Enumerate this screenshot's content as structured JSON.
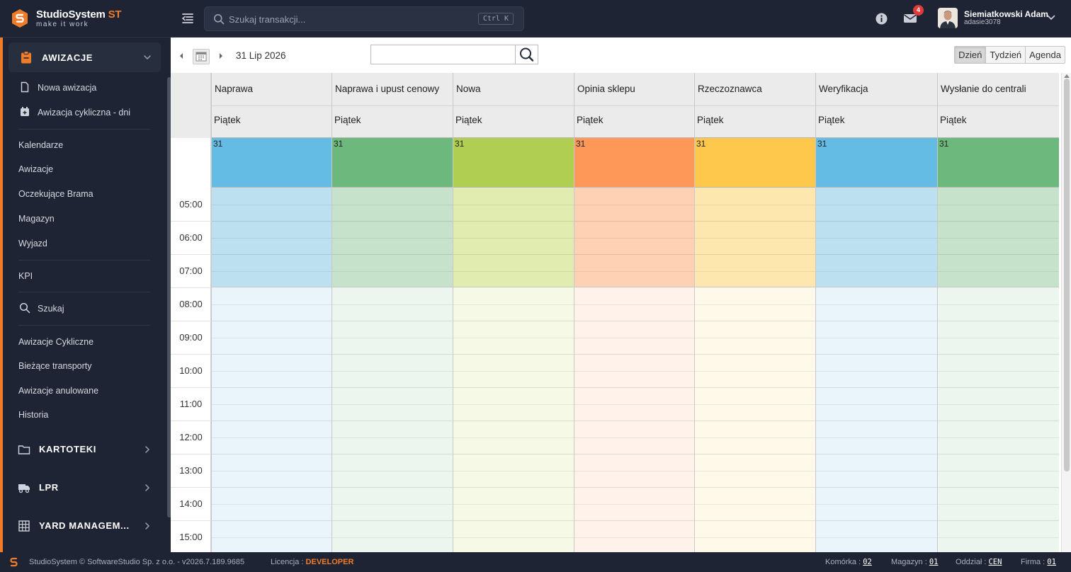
{
  "app": {
    "brand_name": "StudioSystem",
    "brand_suffix": "ST",
    "tagline": "make it work"
  },
  "header": {
    "search_placeholder": "Szukaj transakcji...",
    "search_shortcut": "Ctrl K",
    "notification_count": "4",
    "user_name": "Siemiatkowski Adam",
    "user_login": "adasie3078"
  },
  "sidebar": {
    "active_section": "AWIZACJE",
    "group1": [
      {
        "label": "Nowa awizacja",
        "icon": "document-icon"
      },
      {
        "label": "Awizacja cykliczna - dni",
        "icon": "calendar-plus-icon"
      }
    ],
    "group2": [
      "Kalendarze",
      "Awizacje",
      "Oczekujące Brama",
      "Magazyn",
      "Wyjazd"
    ],
    "group3": [
      "KPI"
    ],
    "search_item": "Szukaj",
    "group4": [
      "Awizacje Cykliczne",
      "Bieżące transporty",
      "Awizacje anulowane",
      "Historia"
    ],
    "sections": [
      {
        "label": "KARTOTEKI",
        "icon": "folder-icon"
      },
      {
        "label": "LPR",
        "icon": "truck-icon"
      },
      {
        "label": "YARD MANAGEM...",
        "icon": "grid-icon"
      }
    ]
  },
  "toolbar": {
    "date_label": "31 Lip 2026",
    "search_value": "",
    "views": [
      "Dzień",
      "Tydzień",
      "Agenda"
    ],
    "active_view": "Dzień"
  },
  "calendar": {
    "columns": [
      {
        "title": "Naprawa",
        "day": "Piątek",
        "date": "31",
        "color": "#64bbe3",
        "off": "#bde0f1",
        "on": "#eaf5fb"
      },
      {
        "title": "Naprawa i upust cenowy",
        "day": "Piątek",
        "date": "31",
        "color": "#6db97d",
        "off": "#c6e2cb",
        "on": "#ecf6ee"
      },
      {
        "title": "Nowa",
        "day": "Piątek",
        "date": "31",
        "color": "#b0ce52",
        "off": "#e0ecb0",
        "on": "#f5f9e6"
      },
      {
        "title": "Opinia sklepu",
        "day": "Piątek",
        "date": "31",
        "color": "#fd9858",
        "off": "#fed1b4",
        "on": "#fff2ea"
      },
      {
        "title": "Rzeczoznawca",
        "day": "Piątek",
        "date": "31",
        "color": "#fec84c",
        "off": "#fee7ae",
        "on": "#fff9ea"
      },
      {
        "title": "Weryfikacja",
        "day": "Piątek",
        "date": "31",
        "color": "#64bbe3",
        "off": "#bde0f1",
        "on": "#eaf5fb"
      },
      {
        "title": "Wysłanie do centrali",
        "day": "Piątek",
        "date": "31",
        "color": "#6db97d",
        "off": "#c6e2cb",
        "on": "#ecf6ee"
      }
    ],
    "times": [
      "05:00",
      "06:00",
      "07:00",
      "08:00",
      "09:00",
      "10:00",
      "11:00",
      "12:00",
      "13:00",
      "14:00",
      "15:00"
    ]
  },
  "footer": {
    "copyright": "StudioSystem © SoftwareStudio Sp. z o.o. - v2026.7.189.9685",
    "license_label": "Licencja :",
    "license_value": "DEVELOPER",
    "komorka_label": "Komórka :",
    "komorka_value": "02",
    "magazyn_label": "Magazyn :",
    "magazyn_value": "01",
    "oddzial_label": "Oddział :",
    "oddzial_value": "CEN",
    "firma_label": "Firma :",
    "firma_value": "01"
  },
  "colors": {
    "accent": "#f07c2a",
    "sidebar_bg": "#1e2433"
  }
}
